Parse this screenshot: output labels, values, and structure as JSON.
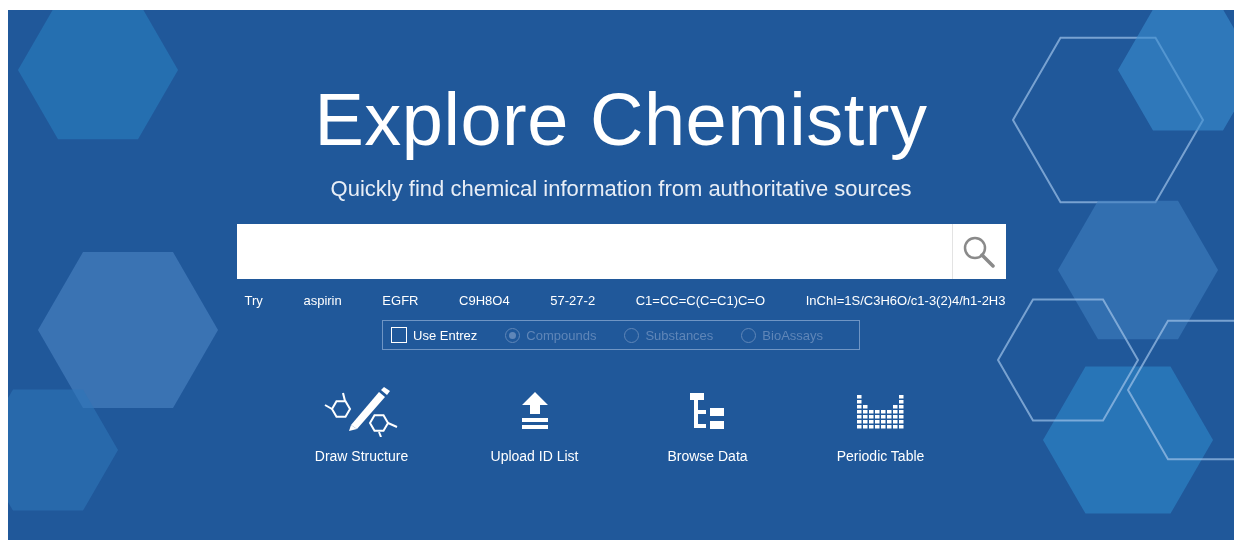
{
  "title": "Explore Chemistry",
  "subtitle": "Quickly find chemical information from authoritative sources",
  "examples": {
    "label": "Try",
    "items": [
      "aspirin",
      "EGFR",
      "C9H8O4",
      "57-27-2",
      "C1=CC=C(C=C1)C=O",
      "InChI=1S/C3H6O/c1-3(2)4/h1-2H3"
    ]
  },
  "options": {
    "checkbox": {
      "label": "Use Entrez",
      "checked": false
    },
    "radios": [
      {
        "label": "Compounds",
        "selected": true,
        "disabled": true
      },
      {
        "label": "Substances",
        "selected": false,
        "disabled": true
      },
      {
        "label": "BioAssays",
        "selected": false,
        "disabled": true
      }
    ]
  },
  "tools": [
    {
      "kind": "draw",
      "label": "Draw Structure"
    },
    {
      "kind": "upload",
      "label": "Upload ID List"
    },
    {
      "kind": "browse",
      "label": "Browse Data"
    },
    {
      "kind": "periodic",
      "label": "Periodic Table"
    }
  ]
}
